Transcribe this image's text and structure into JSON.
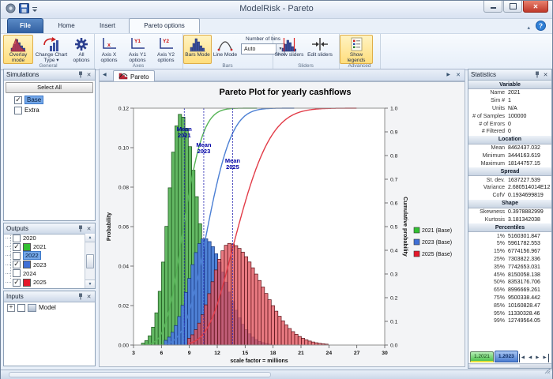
{
  "window": {
    "title": "ModelRisk - Pareto"
  },
  "qat": {
    "icons": [
      "app-icon",
      "save-icon",
      "qat-dropdown-icon"
    ]
  },
  "window_buttons": [
    "minimize",
    "maximize",
    "close"
  ],
  "ribbon": {
    "tabs": [
      {
        "label": "File"
      },
      {
        "label": "Home"
      },
      {
        "label": "Insert"
      },
      {
        "label": "Pareto options",
        "active": true
      }
    ],
    "help_icon": "help-icon",
    "collapse_icon": "chevron-up-icon",
    "groups": [
      {
        "caption": "General",
        "buttons": [
          {
            "label": "Overlay mode",
            "icon": "overlay-mode-icon",
            "active": true
          },
          {
            "label": "Change Chart Type",
            "icon": "change-chart-type-icon",
            "dropdown": true
          },
          {
            "label": "All options",
            "icon": "gear-icon"
          }
        ]
      },
      {
        "caption": "Axes",
        "buttons": [
          {
            "label": "Axis X options",
            "icon": "axis-x-icon"
          },
          {
            "label": "Axis Y1 options",
            "icon": "axis-y1-icon"
          },
          {
            "label": "Axis Y2 options",
            "icon": "axis-y2-icon"
          }
        ]
      },
      {
        "caption": "Bars",
        "buttons": [
          {
            "label": "Bars Mode",
            "icon": "bars-mode-icon",
            "active": true
          },
          {
            "label": "Line Mode",
            "icon": "line-mode-icon"
          }
        ],
        "field": {
          "label": "Number of bins",
          "value": "Auto"
        }
      },
      {
        "caption": "Sliders",
        "buttons": [
          {
            "label": "Show sliders",
            "icon": "show-sliders-icon"
          },
          {
            "label": "Edit sliders",
            "icon": "edit-sliders-icon"
          }
        ]
      },
      {
        "caption": "Advanced",
        "buttons": [
          {
            "label": "Show legends",
            "icon": "show-legends-icon",
            "active": true
          }
        ]
      }
    ]
  },
  "panels": {
    "simulations": {
      "title": "Simulations",
      "select_all": "Select All",
      "items": [
        {
          "label": "Base",
          "checked": true,
          "selected": true
        },
        {
          "label": "Extra",
          "checked": false
        }
      ]
    },
    "outputs": {
      "title": "Outputs",
      "items": [
        {
          "label": "2020",
          "checked": false
        },
        {
          "label": "2021",
          "checked": true,
          "swatch": "#32c032"
        },
        {
          "label": "2022",
          "checked": false,
          "selected": true
        },
        {
          "label": "2023",
          "checked": true,
          "swatch": "#3f6fd6"
        },
        {
          "label": "2024",
          "checked": false
        },
        {
          "label": "2025",
          "checked": true,
          "swatch": "#e5182a"
        }
      ]
    },
    "inputs": {
      "title": "Inputs",
      "items": [
        {
          "label": "Model",
          "checked": false,
          "expandable": true
        }
      ]
    }
  },
  "chart_tab": {
    "label": "Pareto",
    "icon": "pareto-icon"
  },
  "chart_data": {
    "type": "histogram+cdf",
    "title": "Pareto Plot for yearly cashflows",
    "x_axis": {
      "label": "scale factor = millions",
      "min": 3,
      "max": 30,
      "ticks": [
        "3",
        "6",
        "9",
        "12",
        "15",
        "18",
        "21",
        "24",
        "27",
        "30"
      ]
    },
    "y_left": {
      "label": "Probability",
      "min": 0,
      "max": 0.12,
      "ticks": [
        "0.00",
        "0.02",
        "0.04",
        "0.06",
        "0.08",
        "0.10",
        "0.12"
      ]
    },
    "y_right": {
      "label": "Cumulative probability",
      "min": 0,
      "max": 1,
      "ticks": [
        "0.0",
        "0.1",
        "0.2",
        "0.3",
        "0.4",
        "0.5",
        "0.6",
        "0.7",
        "0.8",
        "0.9",
        "1.0"
      ]
    },
    "bin_width": 0.36,
    "legend_position": "right",
    "series": [
      {
        "name": "2021 (Base)",
        "year": "2021",
        "fill": "#63b863",
        "stroke": "#174f17",
        "curve_color": "#56b456",
        "legend_color": "#32c032",
        "mode": 8.05,
        "sd_left": 1.3,
        "sd_right": 1.85,
        "peak": 0.117,
        "range": [
          3.85,
          14.2
        ],
        "curve": [
          4.2,
          16.3
        ],
        "mean_x": 8.46,
        "mean_label": [
          "Mean",
          "2021"
        ],
        "label_p": 0.1085
      },
      {
        "name": "2023 (Base)",
        "year": "2023",
        "fill": "#4f81d6",
        "stroke": "#14337a",
        "curve_color": "#4b7fd4",
        "legend_color": "#3f6fd6",
        "mode": 10.6,
        "sd_left": 1.65,
        "sd_right": 2.3,
        "peak": 0.054,
        "range": [
          6.3,
          18.0
        ],
        "curve": [
          6.6,
          20.3
        ],
        "mean_x": 10.55,
        "mean_label": [
          "Mean",
          "2023"
        ],
        "label_p": 0.1005
      },
      {
        "name": "2025 (Base)",
        "year": "2025",
        "fill": "#e2555e",
        "stroke": "#571016",
        "fill_opacity": 0.78,
        "curve_color": "#e23c48",
        "legend_color": "#e5182a",
        "mode": 13.3,
        "sd_left": 1.85,
        "sd_right": 3.4,
        "peak": 0.0515,
        "range": [
          8.8,
          24.6
        ],
        "curve": [
          8.9,
          27.0
        ],
        "mean_x": 13.65,
        "mean_label": [
          "Mean",
          "2025"
        ],
        "label_p": 0.0925
      }
    ]
  },
  "statistics": {
    "title": "Statistics",
    "sections": [
      {
        "header": "Variable",
        "rows": [
          [
            "Name",
            "2021"
          ],
          [
            "Sim #",
            "1"
          ],
          [
            "Units",
            "N/A"
          ],
          [
            "# of Samples",
            "100000"
          ],
          [
            "# of Errors",
            "0"
          ],
          [
            "# Filtered",
            "0"
          ]
        ]
      },
      {
        "header": "Location",
        "rows": [
          [
            "Mean",
            "8462437.032"
          ],
          [
            "Minimum",
            "3444163.619"
          ],
          [
            "Maximum",
            "18144757.15"
          ]
        ]
      },
      {
        "header": "Spread",
        "rows": [
          [
            "St. dev.",
            "1637227.539"
          ],
          [
            "Variance",
            "2.680514014E12"
          ],
          [
            "CofV",
            "0.1934699819"
          ]
        ]
      },
      {
        "header": "Shape",
        "rows": [
          [
            "Skewness",
            "0.3978882999"
          ],
          [
            "Kurtosis",
            "3.181342038"
          ]
        ]
      },
      {
        "header": "Percentiles",
        "rows": [
          [
            "1%",
            "5160301.847"
          ],
          [
            "5%",
            "5961782.553"
          ],
          [
            "15%",
            "6774156.967"
          ],
          [
            "25%",
            "7303822.336"
          ],
          [
            "35%",
            "7742653.031"
          ],
          [
            "45%",
            "8150058.138"
          ],
          [
            "50%",
            "8353176.706"
          ],
          [
            "65%",
            "8996669.261"
          ],
          [
            "75%",
            "9500338.442"
          ],
          [
            "85%",
            "10160828.47"
          ],
          [
            "95%",
            "11330328.46"
          ],
          [
            "99%",
            "12749564.05"
          ]
        ]
      }
    ],
    "tabs": [
      {
        "label": "1.2021",
        "style": "green"
      },
      {
        "label": "1.2023",
        "style": "blue",
        "active": true
      }
    ]
  }
}
